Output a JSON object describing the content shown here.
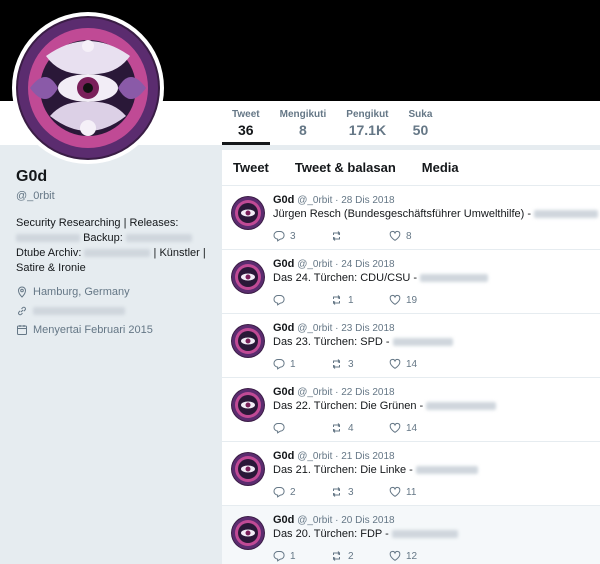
{
  "profile": {
    "name": "G0d",
    "handle": "@_0rbit",
    "bio_line1": "Security Researching | Releases:",
    "bio_backup": "Backup:",
    "bio_dtube": "Dtube Archiv:",
    "bio_kuenstler": "| Künstler |",
    "bio_line4": "Satire & Ironie",
    "location": "Hamburg, Germany",
    "joined": "Menyertai Februari 2015"
  },
  "stats": [
    {
      "label": "Tweet",
      "value": "36"
    },
    {
      "label": "Mengikuti",
      "value": "8"
    },
    {
      "label": "Pengikut",
      "value": "17.1K"
    },
    {
      "label": "Suka",
      "value": "50"
    }
  ],
  "tabs": [
    "Tweet",
    "Tweet & balasan",
    "Media"
  ],
  "tweets": [
    {
      "name": "G0d",
      "handle": "@_0rbit",
      "date": "· 28 Dis 2018",
      "text": "Jürgen Resch (Bundesgeschäftsführer Umwelthilfe) -",
      "replies": "3",
      "retweets": "",
      "likes": "8"
    },
    {
      "name": "G0d",
      "handle": "@_0rbit",
      "date": "· 24 Dis 2018",
      "text": "Das 24. Türchen: CDU/CSU -",
      "replies": "",
      "retweets": "1",
      "likes": "19"
    },
    {
      "name": "G0d",
      "handle": "@_0rbit",
      "date": "· 23 Dis 2018",
      "text": "Das 23. Türchen: SPD -",
      "replies": "1",
      "retweets": "3",
      "likes": "14"
    },
    {
      "name": "G0d",
      "handle": "@_0rbit",
      "date": "· 22 Dis 2018",
      "text": "Das 22. Türchen: Die Grünen -",
      "replies": "",
      "retweets": "4",
      "likes": "14"
    },
    {
      "name": "G0d",
      "handle": "@_0rbit",
      "date": "· 21 Dis 2018",
      "text": "Das 21. Türchen: Die Linke -",
      "replies": "2",
      "retweets": "3",
      "likes": "11"
    },
    {
      "name": "G0d",
      "handle": "@_0rbit",
      "date": "· 20 Dis 2018",
      "text": "Das 20. Türchen: FDP -",
      "replies": "1",
      "retweets": "2",
      "likes": "12"
    }
  ],
  "colors": {
    "accent": "#1da1f2",
    "muted": "#657786",
    "banner": "#000000"
  }
}
